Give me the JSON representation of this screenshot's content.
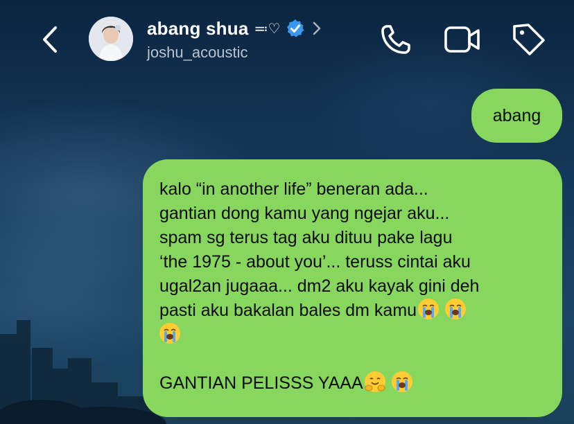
{
  "header": {
    "display_name": "abang shua",
    "name_decoration": "≕♡",
    "username": "joshu_acoustic",
    "verified": true,
    "icons": {
      "back": "chevron-left-icon",
      "profile_chevron": "chevron-right-icon",
      "call": "phone-icon",
      "video": "video-camera-icon",
      "tag": "tag-icon"
    }
  },
  "messages": [
    {
      "sender": "me",
      "text": "abang"
    },
    {
      "sender": "me",
      "lines": [
        "kalo “in another life” beneran ada...",
        "gantian dong kamu yang ngejar aku...",
        "spam sg terus tag aku dituu pake lagu",
        "‘the 1975 - about you’... teruss cintai aku",
        "ugal2an jugaaa... dm2 aku kayak gini deh",
        "pasti aku bakalan bales dm kamu",
        "",
        "",
        "GANTIAN PELISSS YAAA"
      ],
      "emojis": {
        "line6": [
          "loudly-crying-face-emoji",
          "loudly-crying-face-emoji"
        ],
        "line7": [
          "loudly-crying-face-emoji"
        ],
        "line9": [
          "hugging-face-emoji",
          "loudly-crying-face-emoji"
        ]
      }
    }
  ],
  "colors": {
    "bubble": "#87d65d",
    "verified_badge": "#3897f0",
    "background_top": "#0b2540",
    "username": "#b9c4d1"
  }
}
